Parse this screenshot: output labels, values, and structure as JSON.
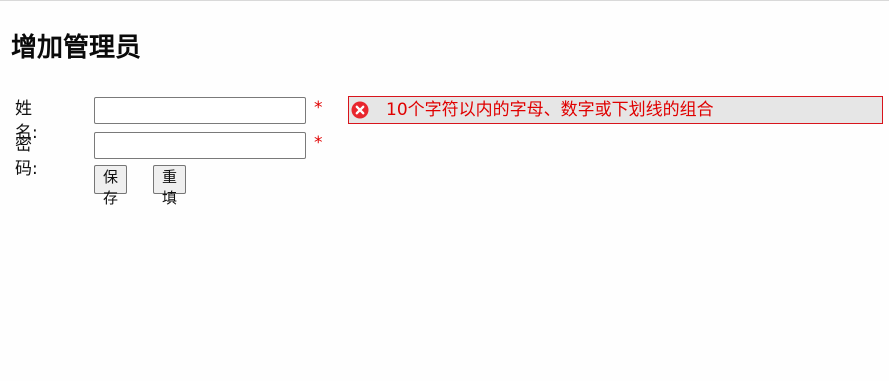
{
  "page": {
    "title": "增加管理员"
  },
  "form": {
    "name_label": "姓名:",
    "name_value": "",
    "password_label": "密码:",
    "password_value": "",
    "required_mark": "*",
    "save_label": "保存",
    "reset_label": "重填"
  },
  "validation": {
    "icon": "error-circle-x-icon",
    "message": "10个字符以内的字母、数字或下划线的组合"
  },
  "colors": {
    "error": "#e00000",
    "error_border": "#d8141c",
    "error_bg": "#e6e6e6"
  }
}
